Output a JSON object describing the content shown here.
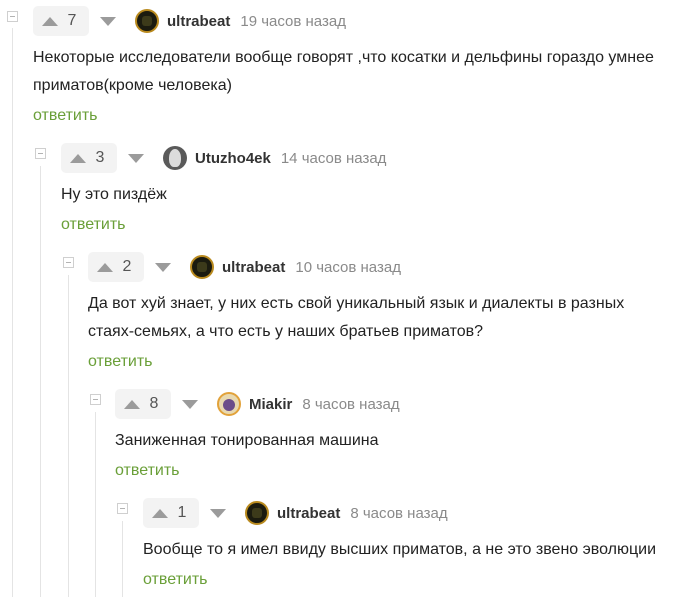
{
  "comments": [
    {
      "votes": "7",
      "author": "ultrabeat",
      "time": "19 часов назад",
      "text_lines": [
        "Некоторые исследователи вообще говорят ,что косатки и дельфины гораздо умнее",
        "приматов(кроме человека)"
      ],
      "reply": "ответить",
      "avatar_icon": "ultrabeat-avatar-icon"
    },
    {
      "votes": "3",
      "author": "Utuzho4ek",
      "time": "14 часов назад",
      "text_lines": [
        "Ну это пиздёж"
      ],
      "reply": "ответить",
      "avatar_icon": "utuzho4ek-avatar-icon"
    },
    {
      "votes": "2",
      "author": "ultrabeat",
      "time": "10 часов назад",
      "text_lines": [
        "Да вот хуй знает, у них есть свой уникальный язык и диалекты в разных",
        "стаях-семьях, а что есть у наших братьев приматов?"
      ],
      "reply": "ответить",
      "avatar_icon": "ultrabeat-avatar-icon"
    },
    {
      "votes": "8",
      "author": "Miakir",
      "time": "8 часов назад",
      "text_lines": [
        "Заниженная тонированная машина"
      ],
      "reply": "ответить",
      "avatar_icon": "miakir-avatar-icon"
    },
    {
      "votes": "1",
      "author": "ultrabeat",
      "time": "8 часов назад",
      "text_lines": [
        "Вообще то я имел ввиду высших приматов, а не это звено эволюции"
      ],
      "reply": "ответить",
      "avatar_icon": "ultrabeat-avatar-icon"
    }
  ],
  "colors": {
    "reply_link": "#6a9f38",
    "vote_bg": "#f3f3f3",
    "arrow": "#9b9b9b",
    "time": "#8a8a8a"
  }
}
